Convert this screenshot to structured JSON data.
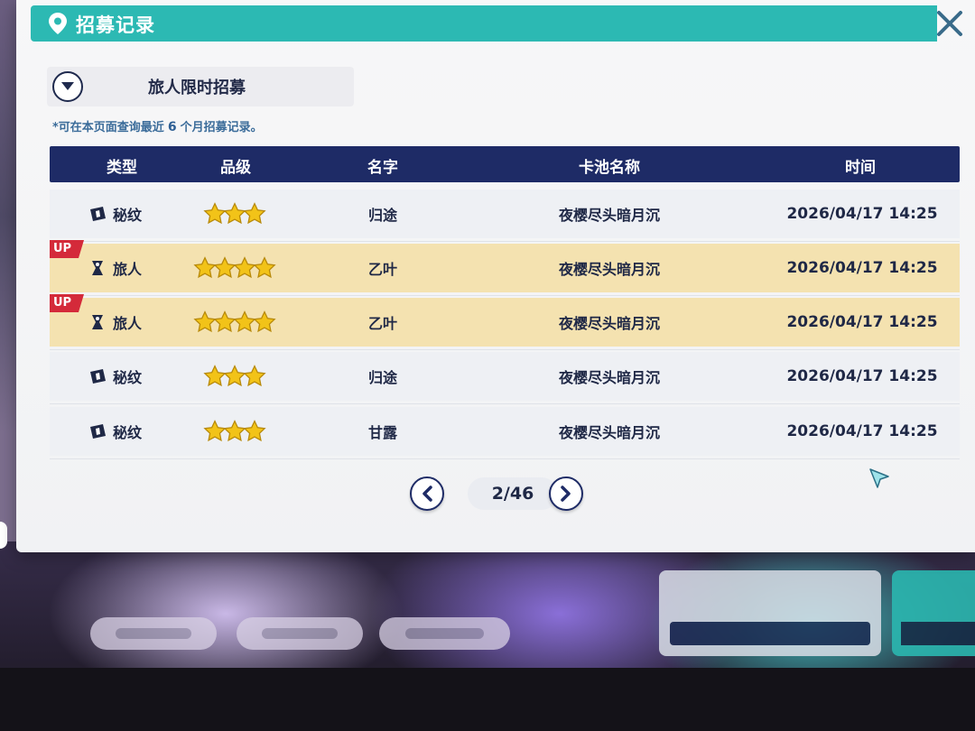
{
  "window": {
    "title": "招募记录"
  },
  "filter": {
    "selected": "旅人限时招募"
  },
  "notice": {
    "prefix": "*可在本页面查询最近",
    "months": "6",
    "suffix": "个月招募记录。"
  },
  "table": {
    "headers": [
      "类型",
      "品级",
      "名字",
      "卡池名称",
      "时间"
    ],
    "rows": [
      {
        "type": "秘纹",
        "type_icon": "rune-icon",
        "stars": 3,
        "up": false,
        "name": "归途",
        "pool": "夜樱尽头暗月沉",
        "time": "2026/04/17 14:25"
      },
      {
        "type": "旅人",
        "type_icon": "traveler-icon",
        "stars": 4,
        "up": true,
        "up_label": "UP",
        "name": "乙叶",
        "pool": "夜樱尽头暗月沉",
        "time": "2026/04/17 14:25"
      },
      {
        "type": "旅人",
        "type_icon": "traveler-icon",
        "stars": 4,
        "up": true,
        "up_label": "UP",
        "name": "乙叶",
        "pool": "夜樱尽头暗月沉",
        "time": "2026/04/17 14:25"
      },
      {
        "type": "秘纹",
        "type_icon": "rune-icon",
        "stars": 3,
        "up": false,
        "name": "归途",
        "pool": "夜樱尽头暗月沉",
        "time": "2026/04/17 14:25"
      },
      {
        "type": "秘纹",
        "type_icon": "rune-icon",
        "stars": 3,
        "up": false,
        "name": "甘露",
        "pool": "夜樱尽头暗月沉",
        "time": "2026/04/17 14:25"
      }
    ]
  },
  "pagination": {
    "page": "2/46"
  },
  "colors": {
    "title_bar": "#2cb9b3",
    "header": "#1e2b66",
    "up_row": "#f4e2b0",
    "up_badge": "#d42a3a",
    "star": "#f2c318"
  }
}
